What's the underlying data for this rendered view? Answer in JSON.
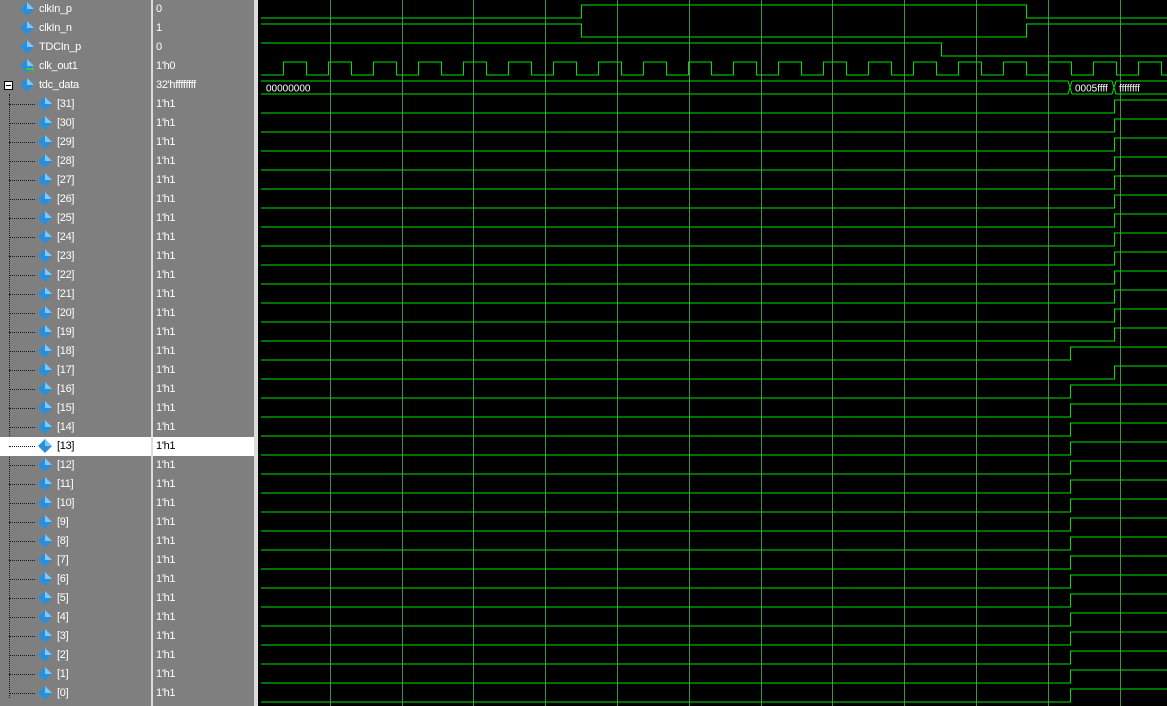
{
  "colors": {
    "panel_bg": "#7f7f7f",
    "divider": "#dcdcdc",
    "wave_bg": "#000000",
    "wave_line": "#00e000",
    "grid": "#4a8a4a",
    "selected_row": "#ffffff",
    "icon_blue": "#2a8fd8"
  },
  "signals": [
    {
      "name": "clkIn_p",
      "value": "0",
      "icon": "signal-diamond-icon"
    },
    {
      "name": "clkIn_n",
      "value": "1",
      "icon": "signal-diamond-icon"
    },
    {
      "name": "TDCIn_p",
      "value": "0",
      "icon": "signal-diamond-icon"
    },
    {
      "name": "clk_out1",
      "value": "1'h0",
      "icon": "clock-output-icon"
    },
    {
      "name": "tdc_data",
      "value": "32'hffffffff",
      "icon": "signal-diamond-icon",
      "expanded": true
    }
  ],
  "bits": [
    {
      "name": "[31]",
      "value": "1'h1",
      "rise_time": 0.942
    },
    {
      "name": "[30]",
      "value": "1'h1",
      "rise_time": 0.942
    },
    {
      "name": "[29]",
      "value": "1'h1",
      "rise_time": 0.942
    },
    {
      "name": "[28]",
      "value": "1'h1",
      "rise_time": 0.942
    },
    {
      "name": "[27]",
      "value": "1'h1",
      "rise_time": 0.942
    },
    {
      "name": "[26]",
      "value": "1'h1",
      "rise_time": 0.942
    },
    {
      "name": "[25]",
      "value": "1'h1",
      "rise_time": 0.942
    },
    {
      "name": "[24]",
      "value": "1'h1",
      "rise_time": 0.942
    },
    {
      "name": "[23]",
      "value": "1'h1",
      "rise_time": 0.942
    },
    {
      "name": "[22]",
      "value": "1'h1",
      "rise_time": 0.942
    },
    {
      "name": "[21]",
      "value": "1'h1",
      "rise_time": 0.942
    },
    {
      "name": "[20]",
      "value": "1'h1",
      "rise_time": 0.942
    },
    {
      "name": "[19]",
      "value": "1'h1",
      "rise_time": 0.942
    },
    {
      "name": "[18]",
      "value": "1'h1",
      "rise_time": 0.893
    },
    {
      "name": "[17]",
      "value": "1'h1",
      "rise_time": 0.942
    },
    {
      "name": "[16]",
      "value": "1'h1",
      "rise_time": 0.893
    },
    {
      "name": "[15]",
      "value": "1'h1",
      "rise_time": 0.893
    },
    {
      "name": "[14]",
      "value": "1'h1",
      "rise_time": 0.893
    },
    {
      "name": "[13]",
      "value": "1'h1",
      "rise_time": 0.893,
      "selected": true
    },
    {
      "name": "[12]",
      "value": "1'h1",
      "rise_time": 0.893
    },
    {
      "name": "[11]",
      "value": "1'h1",
      "rise_time": 0.893
    },
    {
      "name": "[10]",
      "value": "1'h1",
      "rise_time": 0.893
    },
    {
      "name": "[9]",
      "value": "1'h1",
      "rise_time": 0.893
    },
    {
      "name": "[8]",
      "value": "1'h1",
      "rise_time": 0.893
    },
    {
      "name": "[7]",
      "value": "1'h1",
      "rise_time": 0.893
    },
    {
      "name": "[6]",
      "value": "1'h1",
      "rise_time": 0.893
    },
    {
      "name": "[5]",
      "value": "1'h1",
      "rise_time": 0.893
    },
    {
      "name": "[4]",
      "value": "1'h1",
      "rise_time": 0.893
    },
    {
      "name": "[3]",
      "value": "1'h1",
      "rise_time": 0.893
    },
    {
      "name": "[2]",
      "value": "1'h1",
      "rise_time": 0.893
    },
    {
      "name": "[1]",
      "value": "1'h1",
      "rise_time": 0.893
    },
    {
      "name": "[0]",
      "value": "1'h1",
      "rise_time": 0.893
    }
  ],
  "waves": {
    "clkIn_p": {
      "initial": 0,
      "edges": [
        0.355,
        0.845
      ]
    },
    "clkIn_n": {
      "initial": 1,
      "edges": [
        0.355,
        0.845
      ]
    },
    "TDCIn_p": {
      "initial": 1,
      "edges": [
        0.751
      ]
    },
    "clk_out1": {
      "initial": 0,
      "period_fraction": 0.0495,
      "first_edge": 0.0
    },
    "tdc_data_bus": [
      {
        "label": "00000000",
        "start": 0.0
      },
      {
        "label": "0005ffff",
        "start": 0.893
      },
      {
        "label": "ffffffff",
        "start": 0.942
      }
    ],
    "grid_fractions": [
      0.079,
      0.158,
      0.237,
      0.316,
      0.395,
      0.474,
      0.553,
      0.632,
      0.711,
      0.79,
      0.869,
      0.948
    ]
  }
}
